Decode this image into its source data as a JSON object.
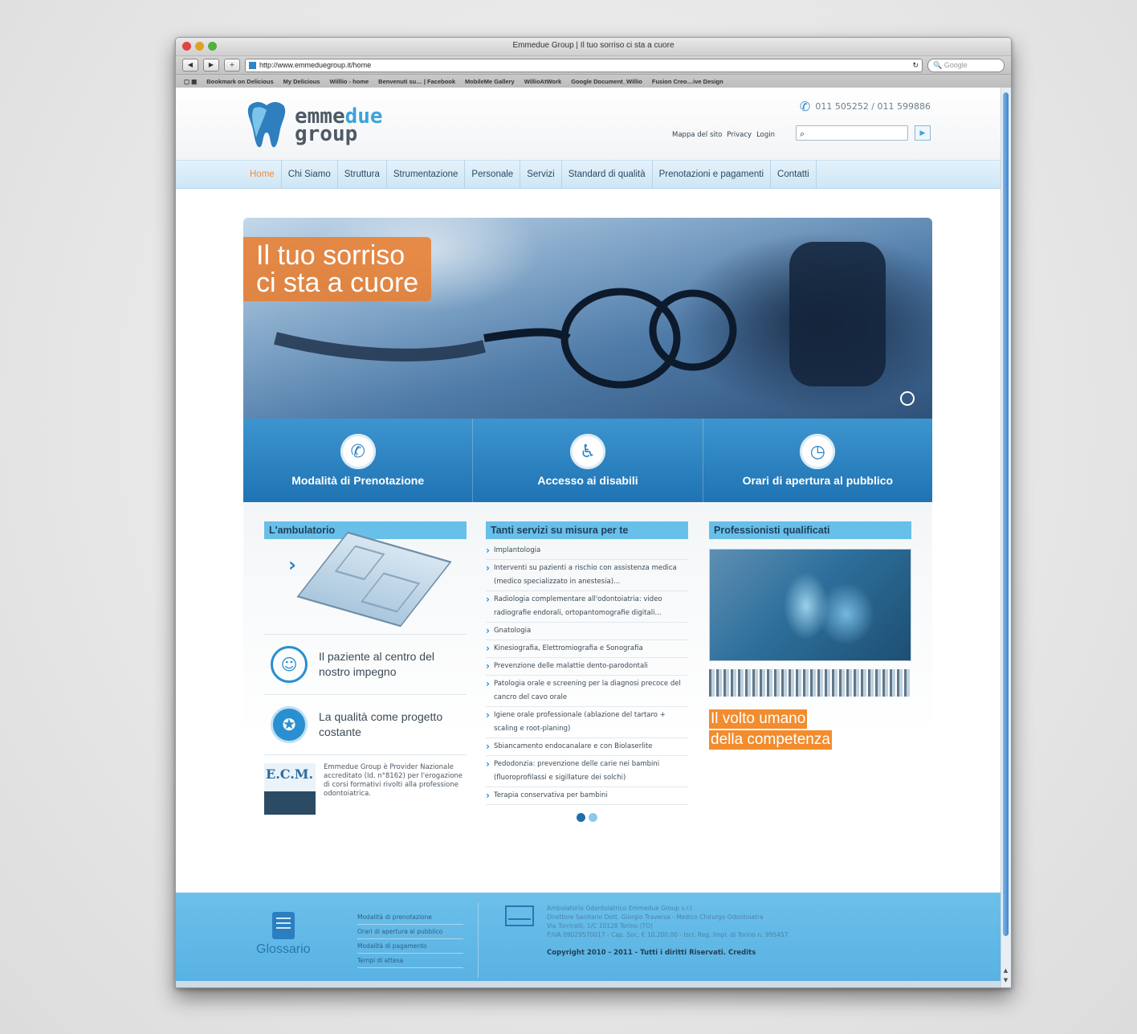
{
  "browser": {
    "window_title": "Emmedue Group | Il tuo sorriso ci sta a cuore",
    "url": "http://www.emmeduegroup.it/home",
    "search_placeholder": "Google",
    "bookmarks": [
      "Bookmark on Delicious",
      "My Delicious",
      "Willlio - home",
      "Benvenuti su… | Facebook",
      "MobileMe Gallery",
      "WillioAtWork",
      "Google Document_Willio",
      "Fusion Creo…ive Design"
    ]
  },
  "header": {
    "logo_line1_a": "emme",
    "logo_line1_b": "due",
    "logo_line2": "group",
    "phone": "011 505252 / 011 599886",
    "links": [
      "Mappa del sito",
      "Privacy",
      "Login"
    ],
    "search_icon": "magnifier-icon",
    "search_button_icon": "arrow-right-icon"
  },
  "nav": {
    "items": [
      "Home",
      "Chi Siamo",
      "Struttura",
      "Strumentazione",
      "Personale",
      "Servizi",
      "Standard di qualità",
      "Prenotazioni e pagamenti",
      "Contatti"
    ],
    "active": "Home"
  },
  "hero": {
    "caption_line1": "Il tuo sorriso",
    "caption_line2": "ci sta a cuore"
  },
  "band": [
    {
      "label": "Modalità di Prenotazione",
      "icon": "phone-icon"
    },
    {
      "label": "Accesso ai disabili",
      "icon": "wheelchair-icon"
    },
    {
      "label": "Orari di apertura al pubblico",
      "icon": "clock-icon"
    }
  ],
  "ambulatorio": {
    "title": "L'ambulatorio",
    "feature1": "Il paziente al centro del nostro impegno",
    "feature2": "La qualità come progetto costante",
    "ecm_logo": "E.C.M.",
    "ecm_text": "Emmedue Group è Provider Nazionale accreditato (Id. n°8162) per l'erogazione di corsi formativi rivolti alla professione odontoiatrica."
  },
  "servizi": {
    "title": "Tanti servizi su misura per te",
    "items": [
      "Implantologia",
      "Interventi su pazienti a rischio con assistenza medica (medico specializzato in anestesia)...",
      "Radiologia complementare all'odontoiatria: video radiografie endorali, ortopantomografie digitali...",
      "Gnatologia",
      "Kinesiografia, Elettromiografia e Sonografia",
      "Prevenzione delle malattie dento-parodontali",
      "Patologia orale e screening per la diagnosi precoce del cancro del cavo orale",
      "Igiene orale professionale (ablazione del tartaro + scaling e root-planing)",
      "Sbiancamento endocanalare e con Biolaserlite",
      "Pedodonzia: prevenzione delle carie nei bambini (fluoroprofilassi e sigillature dei solchi)",
      "Terapia conservativa per bambini"
    ]
  },
  "professionisti": {
    "title": "Professionisti qualificati",
    "tagline1": "Il volto umano",
    "tagline2": "della competenza"
  },
  "footer": {
    "glossary": "Glossario",
    "links": [
      "Modalità di prenotazione",
      "Orari di apertura al pubblico",
      "Modalità di pagamento",
      "Tempi di attesa"
    ],
    "info": [
      "Ambulatorio Odontoiatrico Emmedue Group s.r.l.",
      "Direttore Sanitario Dott. Giorgio Traversa - Medico Chirurgo Odontoiatra",
      "Via Torricelli, 1/C 10128 Torino (TO)",
      "P.IVA 09029570017 - Cap. Soc. € 10.200,00 - Iscr. Reg. Impr. di Torino n. 995457"
    ],
    "copyright": "Copyright 2010 - 2011 - Tutti i diritti Riservati. Credits"
  }
}
